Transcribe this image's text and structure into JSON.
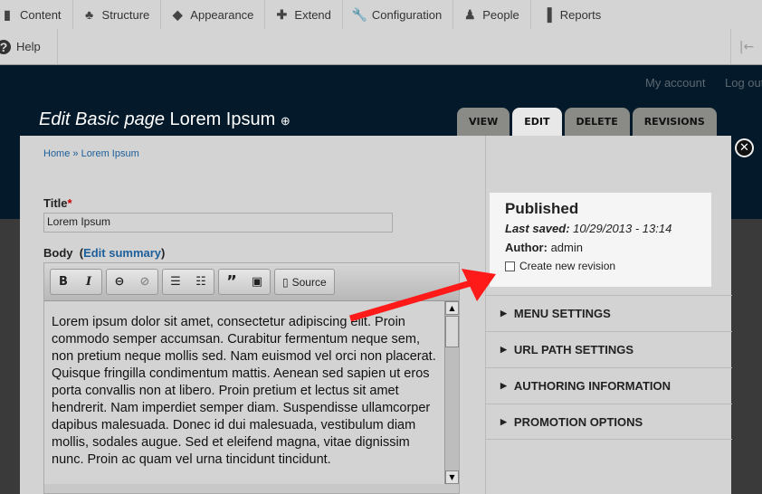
{
  "toolbar": {
    "items": [
      {
        "label": "Content",
        "icon": "content-icon"
      },
      {
        "label": "Structure",
        "icon": "structure-icon"
      },
      {
        "label": "Appearance",
        "icon": "appearance-icon"
      },
      {
        "label": "Extend",
        "icon": "extend-icon"
      },
      {
        "label": "Configuration",
        "icon": "wrench-icon"
      },
      {
        "label": "People",
        "icon": "people-icon"
      },
      {
        "label": "Reports",
        "icon": "reports-icon"
      }
    ],
    "help": "Help"
  },
  "header": {
    "my_account": "My account",
    "log_out": "Log out",
    "title_prefix": "Edit Basic page",
    "title": "Lorem Ipsum",
    "tabs": [
      "VIEW",
      "EDIT",
      "DELETE",
      "REVISIONS"
    ]
  },
  "modal": {
    "breadcrumb": "Home » Lorem Ipsum",
    "title_label": "Title",
    "required": "*",
    "title_value": "Lorem Ipsum",
    "body_label": "Body",
    "edit_summary": "Edit summary",
    "source_label": "Source",
    "body_text": "Lorem ipsum dolor sit amet, consectetur adipiscing elit. Proin commodo semper accumsan. Curabitur fermentum neque sem, non pretium neque mollis sed. Nam euismod vel orci non placerat. Quisque fringilla condimentum mattis. Aenean sed sapien ut eros porta convallis non at libero. Proin pretium et lectus sit amet hendrerit. Nam imperdiet semper diam. Suspendisse ullamcorper dapibus malesuada. Donec id dui malesuada, vestibulum diam mollis, sodales augue. Sed et eleifend magna, vitae dignissim nunc. Proin ac quam vel urna tincidunt tincidunt.",
    "sidebar": {
      "status": "Published",
      "last_saved_label": "Last saved:",
      "last_saved": "10/29/2013 - 13:14",
      "author_label": "Author:",
      "author": "admin",
      "revision_label": "Create new revision",
      "revision_checked": false,
      "sections": [
        "MENU SETTINGS",
        "URL PATH SETTINGS",
        "AUTHORING INFORMATION",
        "PROMOTION OPTIONS"
      ]
    }
  },
  "colors": {
    "arrow": "#ff1a1a",
    "link": "#1d5f9a"
  }
}
